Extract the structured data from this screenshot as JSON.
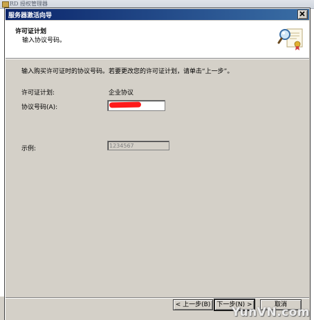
{
  "background_window": {
    "title": "RD 授权管理器"
  },
  "dialog": {
    "title": "服务器激活向导",
    "close_glyph": "✕"
  },
  "header": {
    "title": "许可证计划",
    "subtitle": "输入协议号码。",
    "icon": "certificate-magnifier-icon"
  },
  "body": {
    "intro": "输入购买许可证时的协议号码。若要更改您的许可证计划，请单击“上一步”。",
    "license_plan_label": "许可证计划:",
    "license_plan_value": "企业协议",
    "agreement_number_label": "协议号码(A):",
    "agreement_number_value": "",
    "agreement_number_redacted": true,
    "example_label": "示例:",
    "example_value": "1234567"
  },
  "buttons": {
    "back": "< 上一步(B)",
    "next": "下一步(N) >",
    "cancel": "取消"
  },
  "watermark": "YunVN.com",
  "colors": {
    "titlebar_start": "#0a246a",
    "titlebar_end": "#3a6ea5",
    "dialog_face": "#d4d0c8",
    "redaction": "#ff1a1a"
  }
}
